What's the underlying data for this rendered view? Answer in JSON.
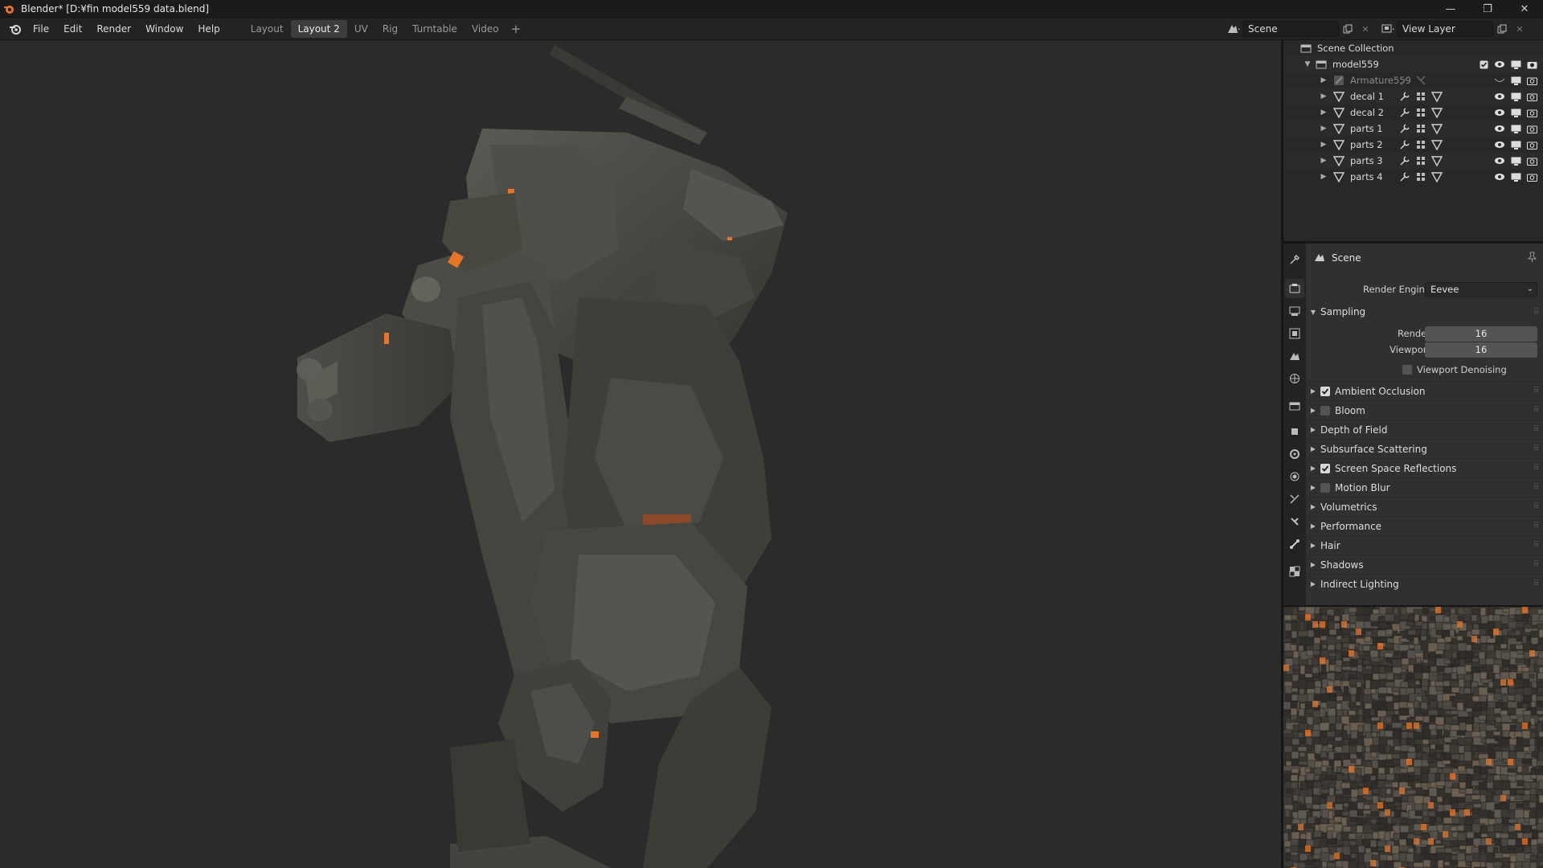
{
  "titlebar": {
    "title": "Blender* [D:¥fin model559 data.blend]",
    "minimize": "—",
    "maximize": "❐",
    "close": "✕"
  },
  "menu": {
    "items": [
      "File",
      "Edit",
      "Render",
      "Window",
      "Help"
    ]
  },
  "workspaces": {
    "tabs": [
      "Layout",
      "Layout 2",
      "UV",
      "Rig",
      "Turntable",
      "Video"
    ],
    "active": "Layout 2",
    "add": "+"
  },
  "header_right": {
    "scene": "Scene",
    "view_layer": "View Layer"
  },
  "outliner": {
    "root": "Scene Collection",
    "collection": "model559",
    "items": [
      {
        "name": "Armature559",
        "type": "armature",
        "muted": true
      },
      {
        "name": "decal 1",
        "type": "mesh"
      },
      {
        "name": "decal 2",
        "type": "mesh"
      },
      {
        "name": "parts 1",
        "type": "mesh"
      },
      {
        "name": "parts 2",
        "type": "mesh"
      },
      {
        "name": "parts 3",
        "type": "mesh"
      },
      {
        "name": "parts 4",
        "type": "mesh"
      }
    ]
  },
  "properties": {
    "context": "Scene",
    "render_engine_label": "Render Engine",
    "render_engine": "Eevee",
    "sampling": {
      "title": "Sampling",
      "render_label": "Render",
      "render_value": "16",
      "viewport_label": "Viewport",
      "viewport_value": "16",
      "denoise_label": "Viewport Denoising",
      "denoise_checked": false
    },
    "panels": [
      {
        "label": "Ambient Occlusion",
        "checkbox": true,
        "checked": true
      },
      {
        "label": "Bloom",
        "checkbox": true,
        "checked": false
      },
      {
        "label": "Depth of Field",
        "checkbox": false
      },
      {
        "label": "Subsurface Scattering",
        "checkbox": false
      },
      {
        "label": "Screen Space Reflections",
        "checkbox": true,
        "checked": true
      },
      {
        "label": "Motion Blur",
        "checkbox": true,
        "checked": false
      },
      {
        "label": "Volumetrics",
        "checkbox": false
      },
      {
        "label": "Performance",
        "checkbox": false
      },
      {
        "label": "Hair",
        "checkbox": false
      },
      {
        "label": "Shadows",
        "checkbox": false
      },
      {
        "label": "Indirect Lighting",
        "checkbox": false
      }
    ]
  },
  "colors": {
    "accent_orange": "#e8742a",
    "viewport_bg": "#2b2b2b",
    "panel_bg": "#303030",
    "mech_gray": "#4a4a44"
  }
}
